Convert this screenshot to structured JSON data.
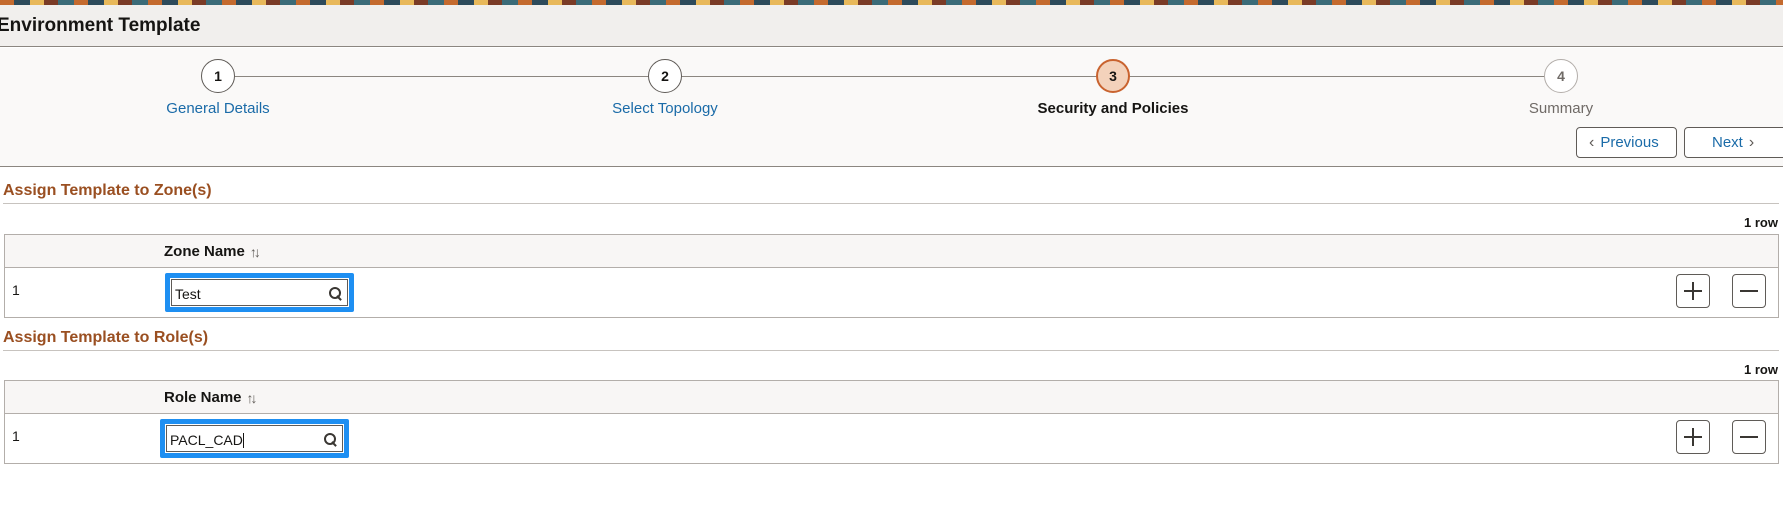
{
  "page": {
    "title": "Environment Template"
  },
  "train": {
    "steps": [
      {
        "number": "1",
        "label": "General Details",
        "state": "visited"
      },
      {
        "number": "2",
        "label": "Select Topology",
        "state": "visited"
      },
      {
        "number": "3",
        "label": "Security and Policies",
        "state": "current"
      },
      {
        "number": "4",
        "label": "Summary",
        "state": "future"
      }
    ],
    "previous_label": "Previous",
    "next_label": "Next"
  },
  "zones": {
    "section_title": "Assign Template to Zone(s)",
    "row_count": "1 row",
    "column_header": "Zone Name",
    "rows": [
      {
        "index": "1",
        "zone_name": "Test"
      }
    ]
  },
  "roles": {
    "section_title": "Assign Template to Role(s)",
    "row_count": "1 row",
    "column_header": "Role Name",
    "rows": [
      {
        "index": "1",
        "role_name": "PACL_CAD"
      }
    ]
  },
  "colors": {
    "link": "#1a6ba8",
    "section_title": "#9a4f21",
    "focus_ring": "#1e8ff2",
    "active_step_fill": "#f3d2bb",
    "active_step_border": "#c9632f"
  },
  "icons": {
    "sort": "sort-icon",
    "search": "search-icon",
    "add": "plus-icon",
    "delete": "minus-icon",
    "previous": "chevron-left-icon",
    "next": "chevron-right-icon"
  }
}
